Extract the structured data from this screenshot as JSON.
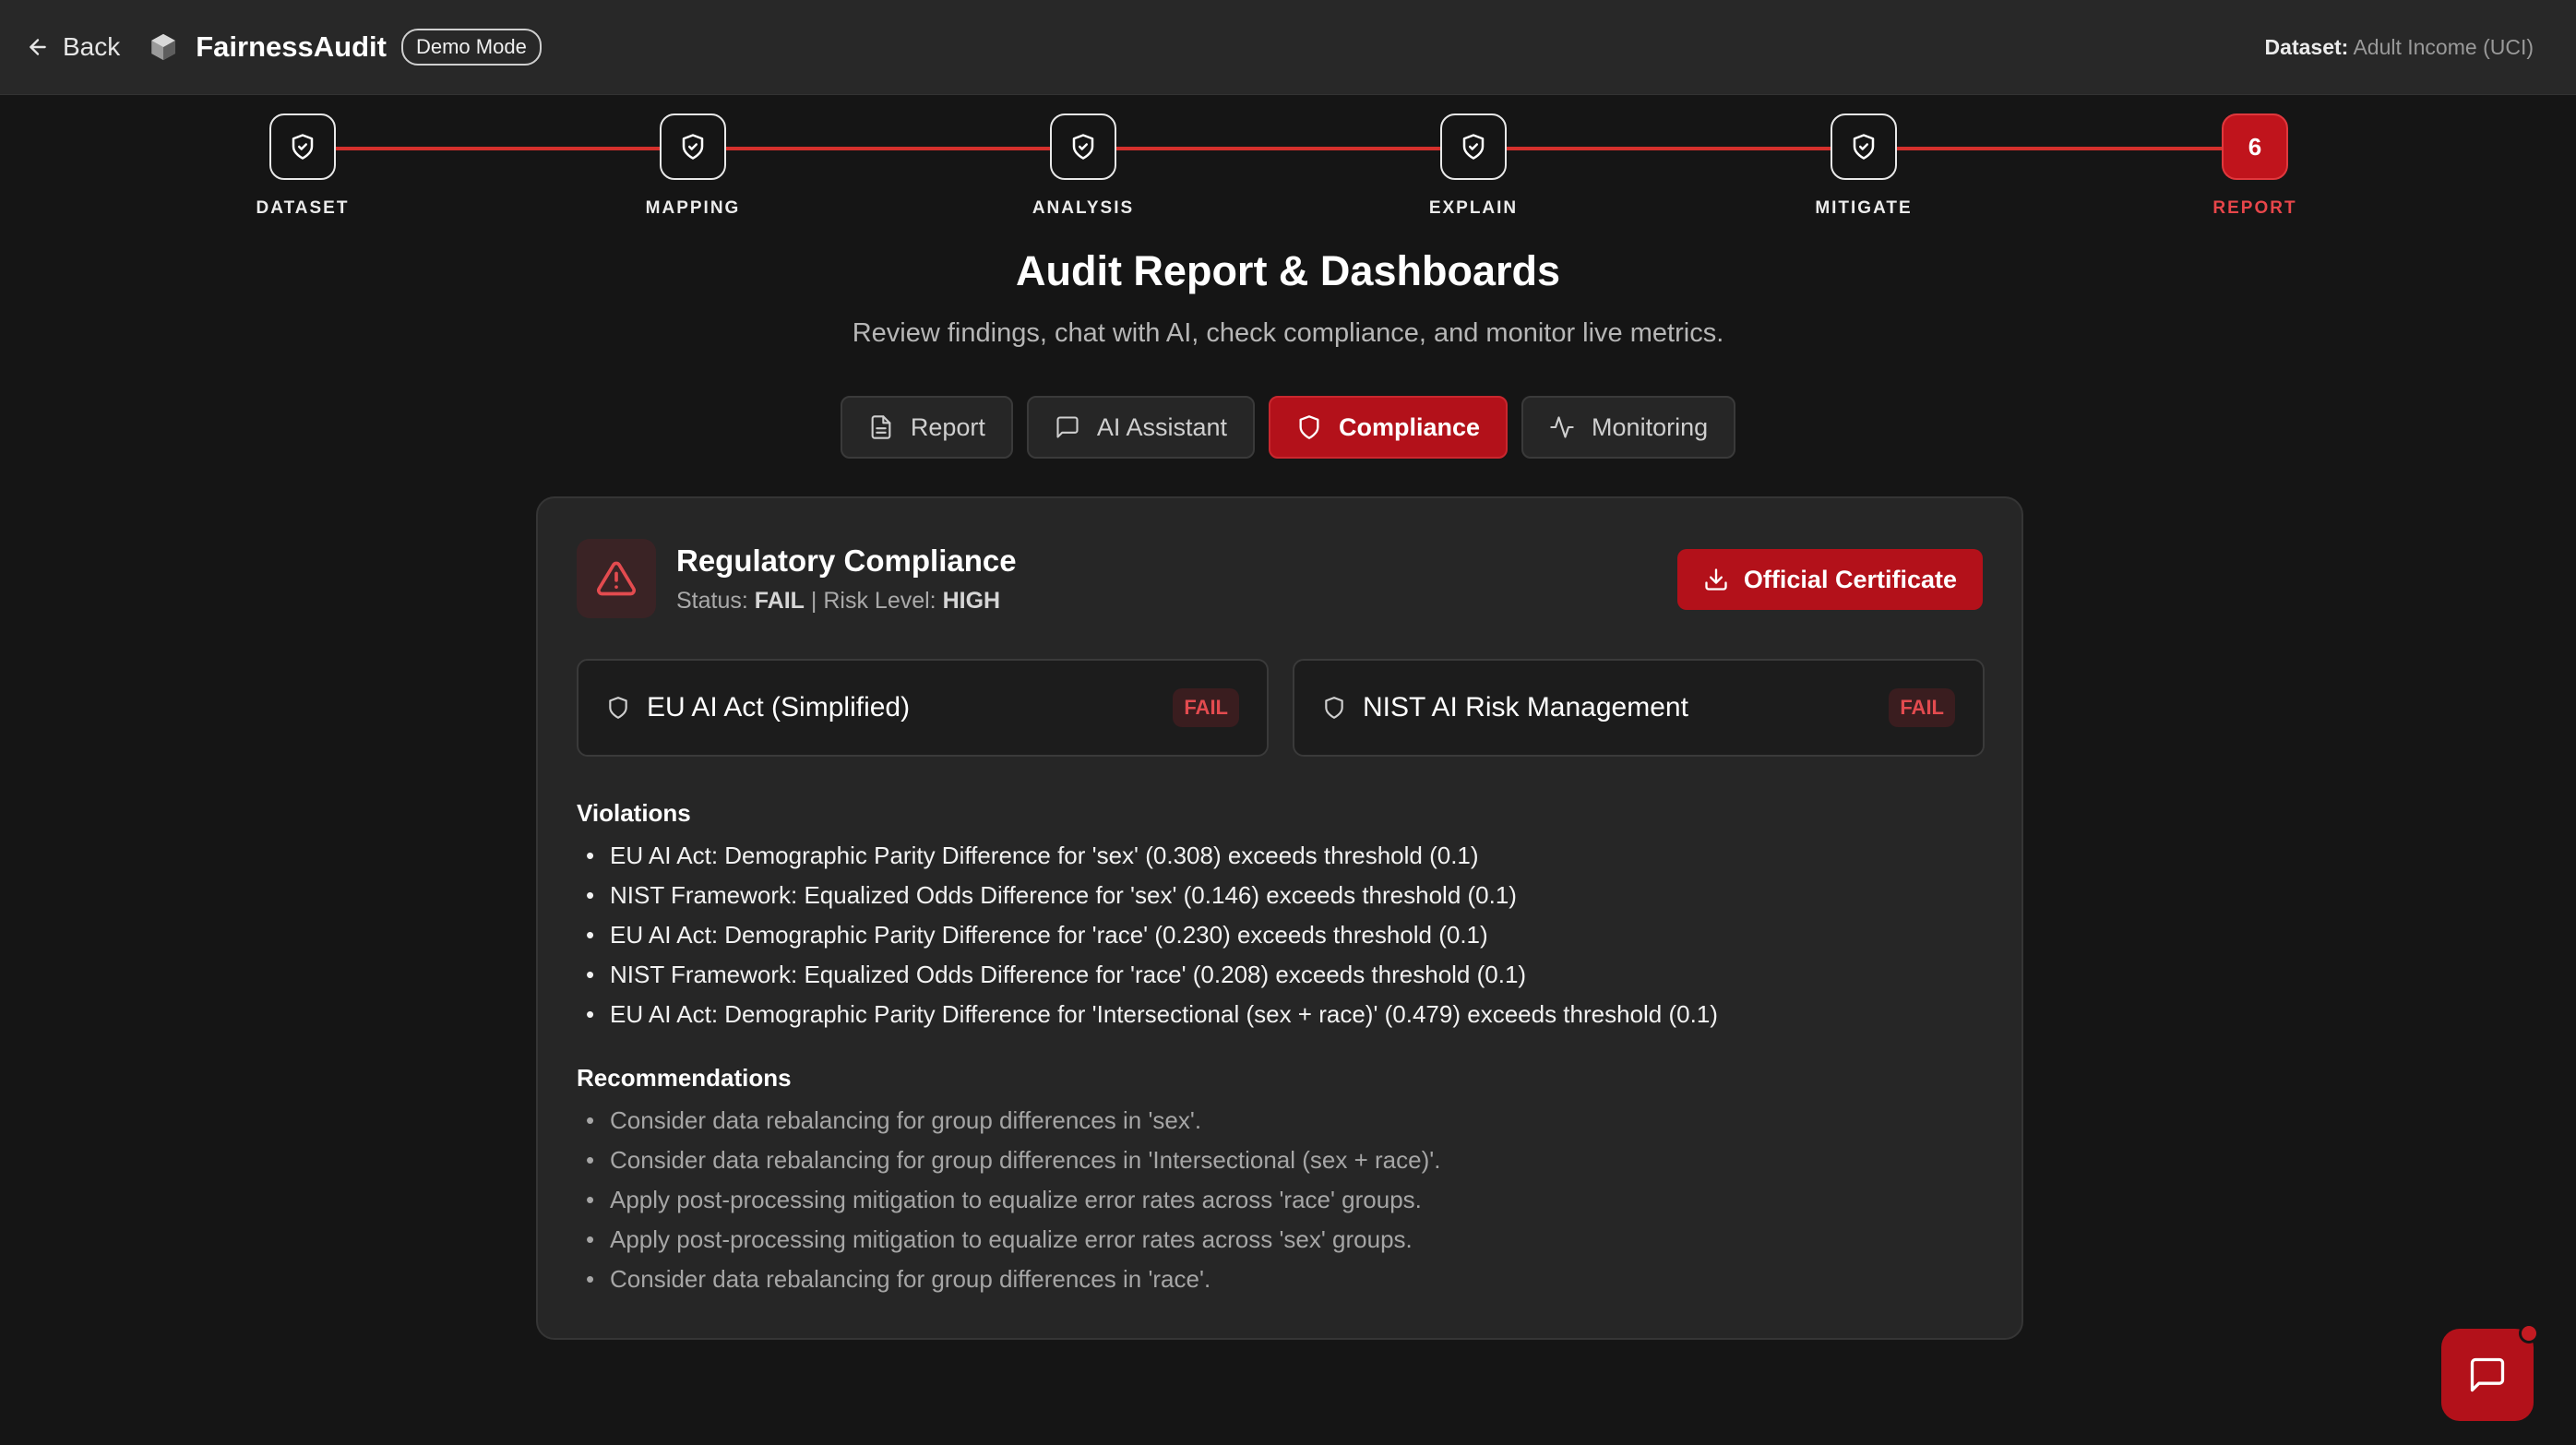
{
  "topbar": {
    "back_label": "Back",
    "app_name": "FairnessAudit",
    "mode_badge": "Demo Mode",
    "dataset_label": "Dataset:",
    "dataset_value": "Adult Income (UCI)"
  },
  "stepper": {
    "steps": [
      {
        "label": "DATASET",
        "status": "complete",
        "icon": "shield-check-icon"
      },
      {
        "label": "MAPPING",
        "status": "complete",
        "icon": "shield-check-icon"
      },
      {
        "label": "ANALYSIS",
        "status": "complete",
        "icon": "shield-check-icon"
      },
      {
        "label": "EXPLAIN",
        "status": "complete",
        "icon": "shield-check-icon"
      },
      {
        "label": "MITIGATE",
        "status": "complete",
        "icon": "shield-check-icon"
      },
      {
        "label": "REPORT",
        "status": "active",
        "number": "6"
      }
    ]
  },
  "header": {
    "title": "Audit Report & Dashboards",
    "subtitle": "Review findings, chat with AI, check compliance, and monitor live metrics."
  },
  "tabs": [
    {
      "label": "Report",
      "icon": "document-icon",
      "active": false
    },
    {
      "label": "AI Assistant",
      "icon": "chat-icon",
      "active": false
    },
    {
      "label": "Compliance",
      "icon": "shield-icon",
      "active": true
    },
    {
      "label": "Monitoring",
      "icon": "activity-icon",
      "active": false
    }
  ],
  "compliance": {
    "title": "Regulatory Compliance",
    "status_label": "Status:",
    "status_value": "FAIL",
    "separator": "|",
    "risk_label": "Risk Level:",
    "risk_value": "HIGH",
    "certificate_button": "Official Certificate",
    "frameworks": [
      {
        "name": "EU AI Act (Simplified)",
        "result": "FAIL"
      },
      {
        "name": "NIST AI Risk Management",
        "result": "FAIL"
      }
    ],
    "violations_title": "Violations",
    "violations": [
      "EU AI Act: Demographic Parity Difference for 'sex' (0.308) exceeds threshold (0.1)",
      "NIST Framework: Equalized Odds Difference for 'sex' (0.146) exceeds threshold (0.1)",
      "EU AI Act: Demographic Parity Difference for 'race' (0.230) exceeds threshold (0.1)",
      "NIST Framework: Equalized Odds Difference for 'race' (0.208) exceeds threshold (0.1)",
      "EU AI Act: Demographic Parity Difference for 'Intersectional (sex + race)' (0.479) exceeds threshold (0.1)"
    ],
    "recommendations_title": "Recommendations",
    "recommendations": [
      "Consider data rebalancing for group differences in 'sex'.",
      "Consider data rebalancing for group differences in 'Intersectional (sex + race)'.",
      "Apply post-processing mitigation to equalize error rates across 'race' groups.",
      "Apply post-processing mitigation to equalize error rates across 'sex' groups.",
      "Consider data rebalancing for group differences in 'race'."
    ]
  },
  "colors": {
    "accent": "#b3111a",
    "fail_text": "#e34b4f",
    "background": "#151515",
    "card": "#262626"
  }
}
